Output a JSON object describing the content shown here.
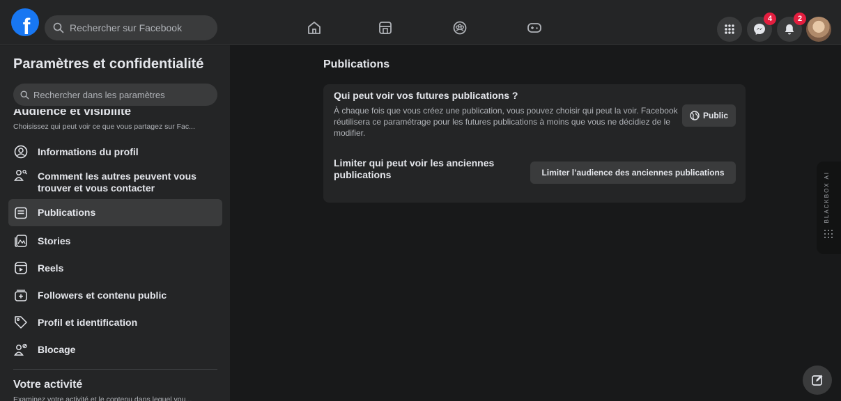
{
  "topbar": {
    "logo_letter": "f",
    "search_placeholder": "Rechercher sur Facebook",
    "nav_icons": [
      "home-icon",
      "marketplace-icon",
      "groups-icon",
      "gaming-icon"
    ],
    "messenger_badge": "4",
    "notifications_badge": "2",
    "accent_color": "#1877f2",
    "badge_color": "#e41e3f"
  },
  "sidebar": {
    "title": "Paramètres et confidentialité",
    "search_placeholder": "Rechercher dans les paramètres",
    "section_title": "Audience et visibilité",
    "section_desc": "Choisissez qui peut voir ce que vous partagez sur Fac...",
    "items": [
      {
        "label": "Informations du profil",
        "icon": "profile-icon"
      },
      {
        "label": "Comment les autres peuvent vous trouver et vous contacter",
        "icon": "people-search-icon"
      },
      {
        "label": "Publications",
        "icon": "posts-icon"
      },
      {
        "label": "Stories",
        "icon": "stories-icon"
      },
      {
        "label": "Reels",
        "icon": "reels-icon"
      },
      {
        "label": "Followers et contenu public",
        "icon": "followers-icon"
      },
      {
        "label": "Profil et identification",
        "icon": "tag-icon"
      },
      {
        "label": "Blocage",
        "icon": "block-icon"
      }
    ],
    "activity_title": "Votre activité",
    "activity_desc": "Examinez votre activité et le contenu dans lequel vou..."
  },
  "main": {
    "title": "Publications",
    "future_title": "Qui peut voir vos futures publications ?",
    "future_desc": "À chaque fois que vous créez une publication, vous pouvez choisir qui peut la voir. Facebook réutilisera ce paramétrage pour les futures publications à moins que vous ne décidiez de le modifier.",
    "public_button": "Public",
    "limit_title": "Limiter qui peut voir les anciennes publications",
    "limit_button": "Limiter l’audience des anciennes publications"
  },
  "blackbox": {
    "label": "BLACKBOX AI"
  }
}
